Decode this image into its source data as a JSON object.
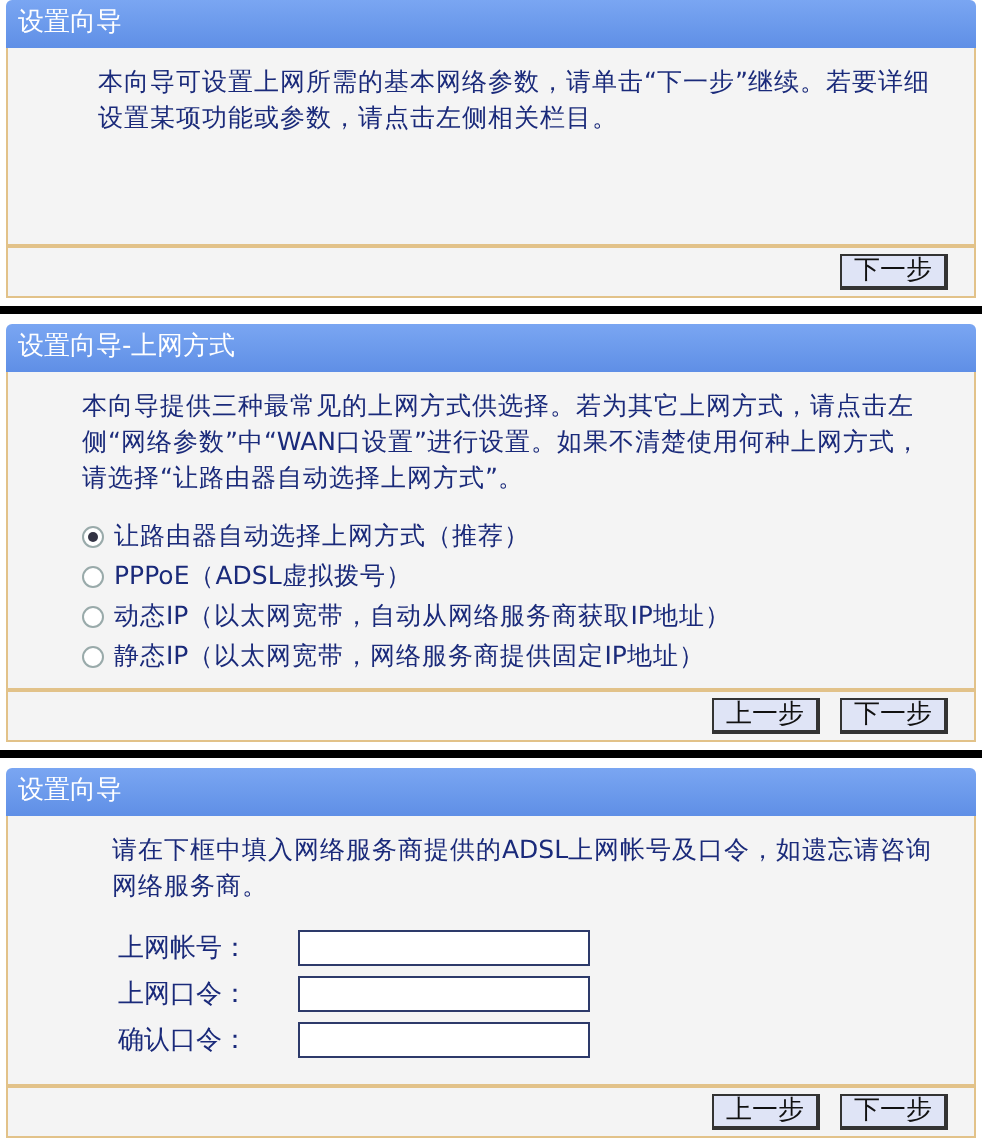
{
  "panels": [
    {
      "title": "设置向导",
      "content": [
        {
          "kind": "text",
          "text": "本向导可设置上网所需的基本网络参数，请单击“下一步”继续。若要详细设置某项功能或参数，请点击左侧相关栏目。"
        }
      ],
      "buttons": [
        "下一步"
      ]
    },
    {
      "title": "设置向导-上网方式",
      "content": [
        {
          "kind": "text",
          "text": "本向导提供三种最常见的上网方式供选择。若为其它上网方式，请点击左侧“网络参数”中“WAN口设置”进行设置。如果不清楚使用何种上网方式，请选择“让路由器自动选择上网方式”。"
        },
        {
          "kind": "radio",
          "label": "让路由器自动选择上网方式（推荐）",
          "selected": true
        },
        {
          "kind": "radio",
          "label": "PPPoE（ADSL虚拟拨号）",
          "selected": false
        },
        {
          "kind": "radio",
          "label": "动态IP（以太网宽带，自动从网络服务商获取IP地址）",
          "selected": false
        },
        {
          "kind": "radio",
          "label": "静态IP（以太网宽带，网络服务商提供固定IP地址）",
          "selected": false
        }
      ],
      "buttons": [
        "上一步",
        "下一步"
      ]
    },
    {
      "title": "设置向导",
      "content": [
        {
          "kind": "text",
          "text": "请在下框中填入网络服务商提供的ADSL上网帐号及口令，如遗忘请咨询网络服务商。"
        },
        {
          "kind": "field",
          "label": "上网帐号："
        },
        {
          "kind": "field",
          "label": "上网口令："
        },
        {
          "kind": "field",
          "label": "确认口令："
        }
      ],
      "buttons": [
        "上一步",
        "下一步"
      ]
    }
  ]
}
